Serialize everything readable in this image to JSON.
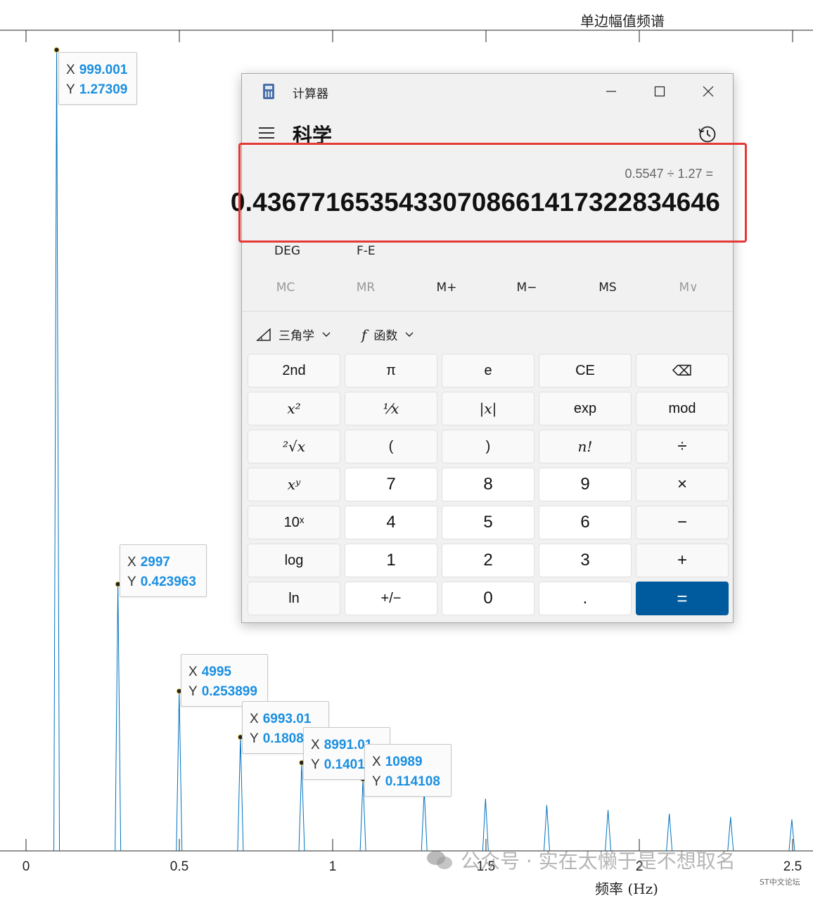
{
  "plot": {
    "title": "单边幅值频谱",
    "xlabel": "频率 (Hz)",
    "x_ticks": [
      "0",
      "0.5",
      "1",
      "1.5",
      "2",
      "2.5"
    ],
    "datatips": [
      {
        "x_label": "X",
        "x": "999.001",
        "y_label": "Y",
        "y": "1.27309"
      },
      {
        "x_label": "X",
        "x": "2997",
        "y_label": "Y",
        "y": "0.423963"
      },
      {
        "x_label": "X",
        "x": "4995",
        "y_label": "Y",
        "y": "0.253899"
      },
      {
        "x_label": "X",
        "x": "6993.01",
        "y_label": "Y",
        "y": "0.1808"
      },
      {
        "x_label": "X",
        "x": "8991.01",
        "y_label": "Y",
        "y": "0.1401"
      },
      {
        "x_label": "X",
        "x": "10989",
        "y_label": "Y",
        "y": "0.114108"
      }
    ],
    "line_color": "#0072bd"
  },
  "chart_data": {
    "type": "line",
    "title": "单边幅值频谱",
    "xlabel": "频率 (Hz)",
    "ylabel": "",
    "x_tick_labels": [
      "0",
      "0.5",
      "1",
      "1.5",
      "2",
      "2.5"
    ],
    "series": [
      {
        "x": [
          999.001,
          2997,
          4995,
          6993.01,
          8991.01,
          10989,
          12987,
          14985,
          16983,
          18981,
          20979,
          22977,
          24975
        ],
        "y": [
          1.27309,
          0.423963,
          0.253899,
          0.1808,
          0.1401,
          0.114108,
          0.096,
          0.083,
          0.073,
          0.065,
          0.059,
          0.054,
          0.05
        ]
      }
    ]
  },
  "calculator": {
    "app_title": "计算器",
    "mode": "科学",
    "expression": "0.5547 ÷ 1.27 =",
    "result": "0.43677165354330708661417322834646",
    "angle_unit": "DEG",
    "fe": "F-E",
    "memory": [
      "MC",
      "MR",
      "M+",
      "M−",
      "MS",
      "M∨"
    ],
    "trig_label": "三角学",
    "func_label": "函数",
    "func_symbol": "f",
    "keys": {
      "r0": [
        "2nd",
        "π",
        "e",
        "CE",
        "⌫"
      ],
      "r1": [
        "x²",
        "¹⁄x",
        "|x|",
        "exp",
        "mod"
      ],
      "r2": [
        "²√x",
        "(",
        ")",
        "n!",
        "÷"
      ],
      "r3": [
        "xʸ",
        "7",
        "8",
        "9",
        "×"
      ],
      "r4": [
        "10ˣ",
        "4",
        "5",
        "6",
        "−"
      ],
      "r5": [
        "log",
        "1",
        "2",
        "3",
        "+"
      ],
      "r6": [
        "ln",
        "+/−",
        "0",
        ".",
        "="
      ]
    },
    "accent": "#005a9e"
  },
  "watermark": {
    "text": "公众号 · 实在太懒于是不想取名",
    "sub": "ST中文论坛"
  }
}
